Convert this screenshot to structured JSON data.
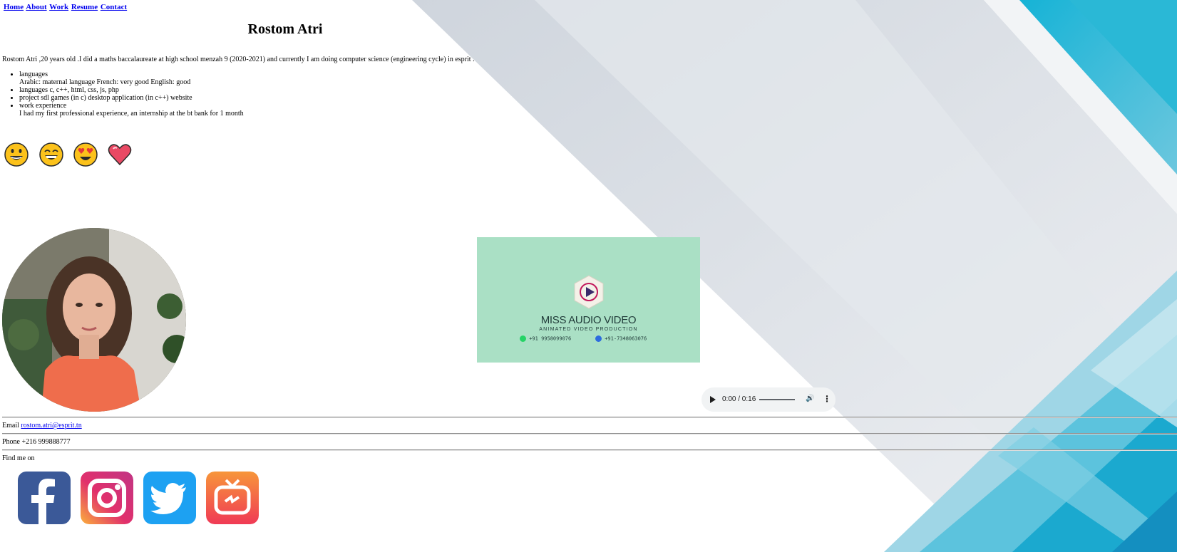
{
  "nav": {
    "home": "Home",
    "about": "About",
    "work": "Work",
    "resume": "Resume",
    "contact": "Contact"
  },
  "header": {
    "title": "Rostom Atri"
  },
  "intro": "Rostom Atri ,20 years old .I did a maths baccalaureate at high school menzah 9 (2020-2021) and currently I am doing computer science (engineering cycle) in esprit .",
  "skills": [
    {
      "title": "languages",
      "detail": "Arabic: maternal language French: very good English: good"
    },
    {
      "title": "languages c, c++, html, css, js, php",
      "detail": ""
    },
    {
      "title": "project sdl games (in c) desktop application (in c++) website",
      "detail": ""
    },
    {
      "title": "work experience",
      "detail": "I had my first professional experience, an internship at the bt bank for 1 month"
    }
  ],
  "emojis": [
    "grinning-face",
    "beaming-face",
    "heart-eyes-face",
    "heart"
  ],
  "video": {
    "brand": "MISS AUDIO VIDEO",
    "tagline": "ANIMATED VIDEO PRODUCTION",
    "phone_whatsapp": "+91 9958099076",
    "phone_call": "+91-7348063076"
  },
  "audio": {
    "time": "0:00 / 0:16"
  },
  "contact": {
    "email_label": "Email",
    "email": "rostom.atri@esprit.tn",
    "phone_label": "Phone",
    "phone": "+216 999888777",
    "find_me": "Find me on"
  },
  "social": [
    "facebook",
    "instagram",
    "twitter",
    "igtv"
  ],
  "colors": {
    "link": "#0000ee",
    "video_bg": "#aae0c5",
    "facebook": "#3b5998",
    "twitter": "#1da1f2",
    "bg_cyan": "#1aaed0"
  }
}
